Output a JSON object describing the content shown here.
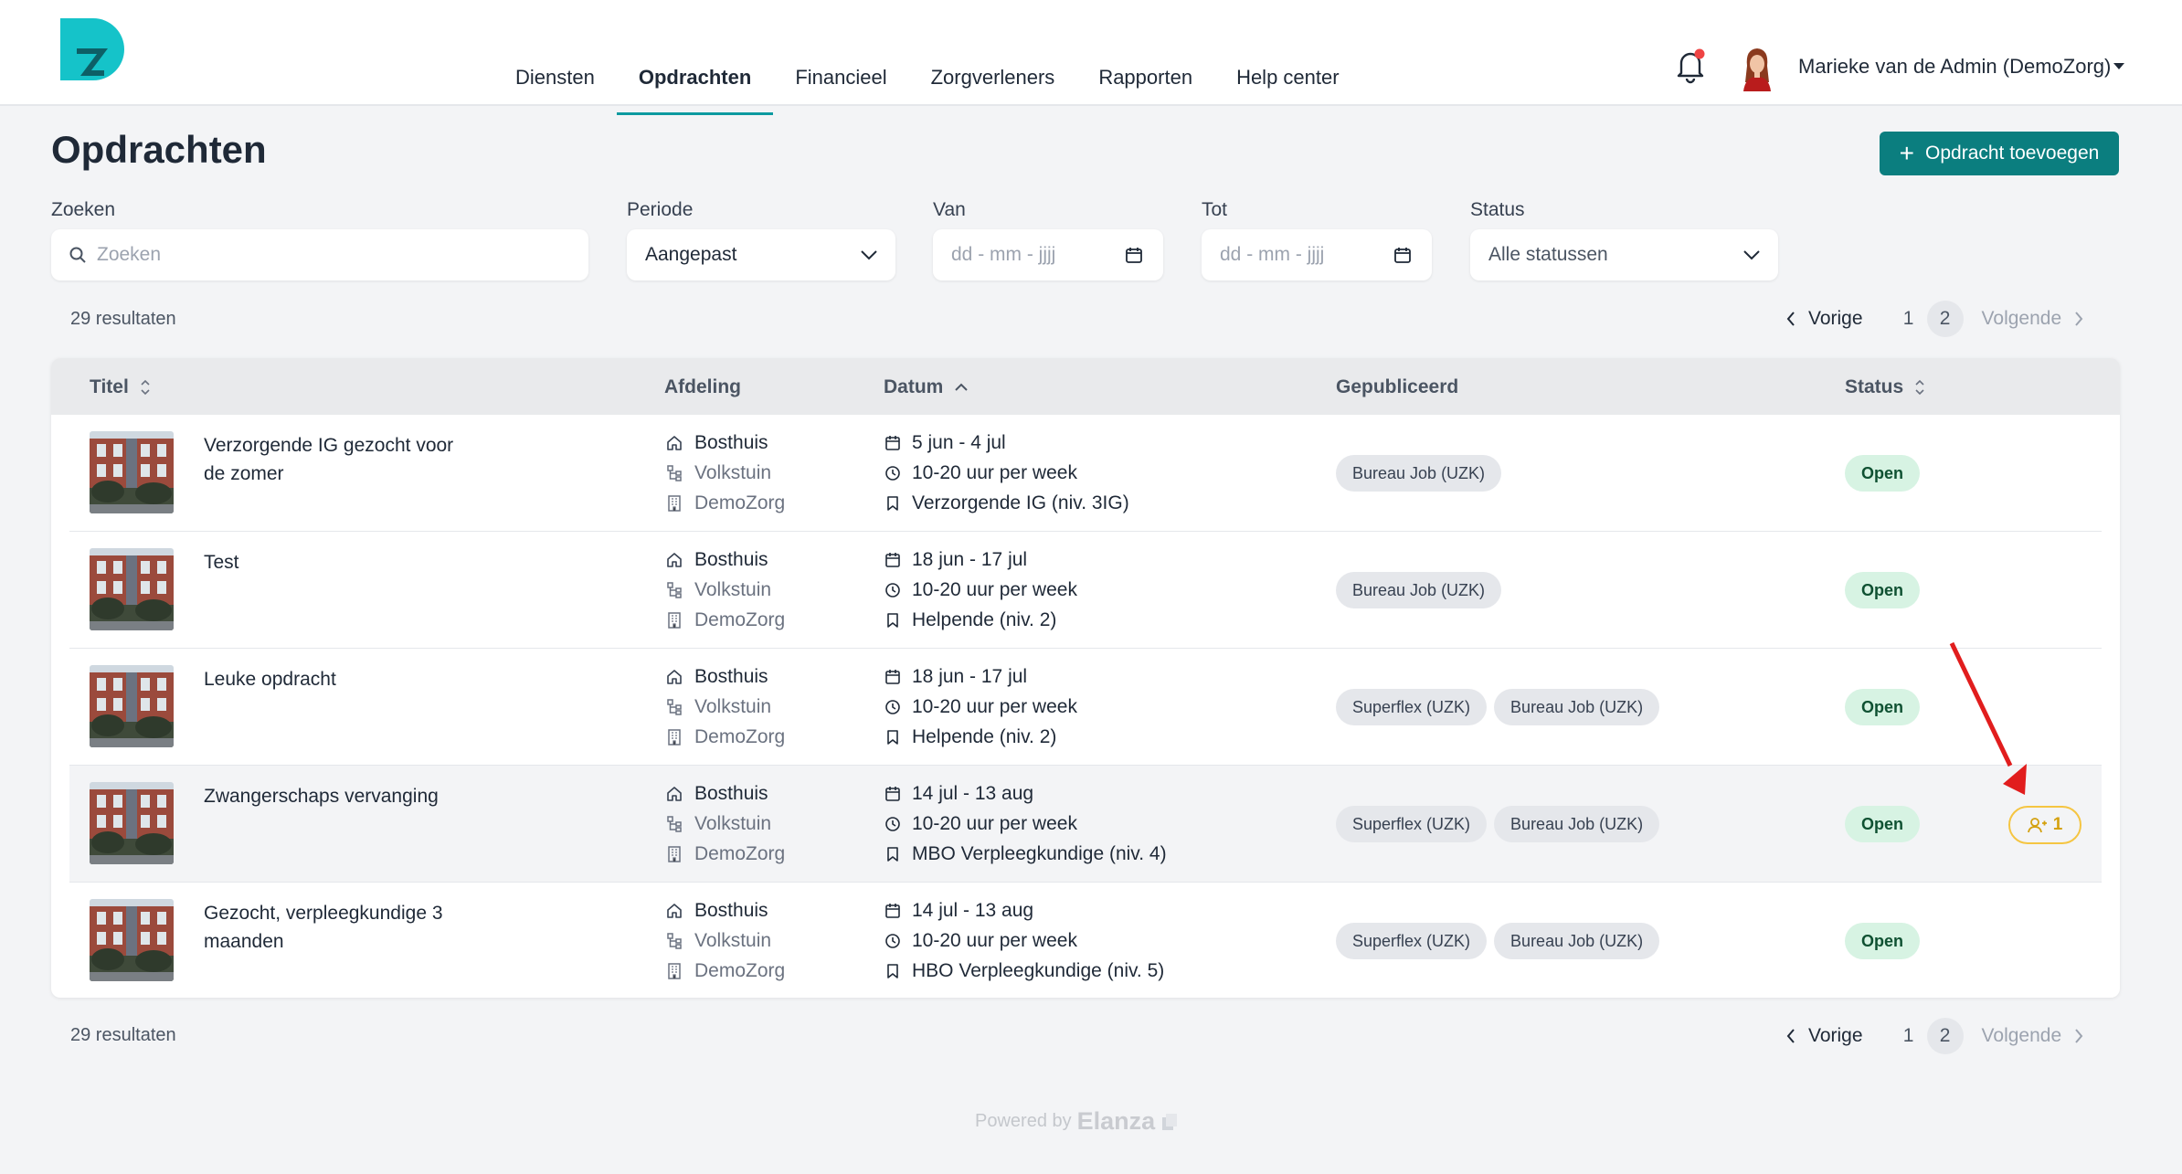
{
  "header": {
    "nav": [
      {
        "label": "Diensten"
      },
      {
        "label": "Opdrachten"
      },
      {
        "label": "Financieel"
      },
      {
        "label": "Zorgverleners"
      },
      {
        "label": "Rapporten"
      },
      {
        "label": "Help center"
      }
    ],
    "active_nav": "Opdrachten",
    "user_name": "Marieke van de Admin (DemoZorg)",
    "notification_dot_color": "#ef4444"
  },
  "page": {
    "title": "Opdrachten",
    "add_button": "Opdracht toevoegen"
  },
  "filters": {
    "search_label": "Zoeken",
    "search_placeholder": "Zoeken",
    "period_label": "Periode",
    "period_value": "Aangepast",
    "from_label": "Van",
    "from_placeholder": "dd - mm - jjjj",
    "to_label": "Tot",
    "to_placeholder": "dd - mm - jjjj",
    "status_label": "Status",
    "status_value": "Alle statussen"
  },
  "pagination": {
    "results": "29 resultaten",
    "prev": "Vorige",
    "pages": [
      "1",
      "2"
    ],
    "current": "2",
    "next": "Volgende"
  },
  "table": {
    "columns": {
      "title": "Titel",
      "department": "Afdeling",
      "date": "Datum",
      "published": "Gepubliceerd",
      "status": "Status"
    },
    "rows": [
      {
        "title": "Verzorgende IG gezocht voor de zomer",
        "location": "Bosthuis",
        "department": "Volkstuin",
        "organization": "DemoZorg",
        "dates": "5 jun - 4 jul",
        "hours": "10-20 uur per week",
        "role": "Verzorgende IG (niv. 3IG)",
        "published": [
          "Bureau Job (UZK)"
        ],
        "status": "Open"
      },
      {
        "title": "Test",
        "location": "Bosthuis",
        "department": "Volkstuin",
        "organization": "DemoZorg",
        "dates": "18 jun - 17 jul",
        "hours": "10-20 uur per week",
        "role": "Helpende (niv. 2)",
        "published": [
          "Bureau Job (UZK)"
        ],
        "status": "Open"
      },
      {
        "title": "Leuke opdracht",
        "location": "Bosthuis",
        "department": "Volkstuin",
        "organization": "DemoZorg",
        "dates": "18 jun - 17 jul",
        "hours": "10-20 uur per week",
        "role": "Helpende (niv. 2)",
        "published": [
          "Superflex (UZK)",
          "Bureau Job (UZK)"
        ],
        "status": "Open"
      },
      {
        "title": "Zwangerschaps vervanging",
        "location": "Bosthuis",
        "department": "Volkstuin",
        "organization": "DemoZorg",
        "dates": "14 jul - 13 aug",
        "hours": "10-20 uur per week",
        "role": "MBO Verpleegkundige (niv. 4)",
        "published": [
          "Superflex (UZK)",
          "Bureau Job (UZK)"
        ],
        "status": "Open",
        "candidates": "1"
      },
      {
        "title": "Gezocht, verpleegkundige 3 maanden",
        "location": "Bosthuis",
        "department": "Volkstuin",
        "organization": "DemoZorg",
        "dates": "14 jul - 13 aug",
        "hours": "10-20 uur per week",
        "role": "HBO Verpleegkundige (niv. 5)",
        "published": [
          "Superflex (UZK)",
          "Bureau Job (UZK)"
        ],
        "status": "Open"
      }
    ]
  },
  "footer": {
    "powered_by": "Powered by",
    "brand": "Elanza"
  },
  "colors": {
    "primary": "#0b7e7f",
    "logo": "#15c3c9",
    "status_open_bg": "#d7f3e3",
    "candidate_badge": "#f5c542",
    "annotation_arrow": "#e11d1d"
  }
}
